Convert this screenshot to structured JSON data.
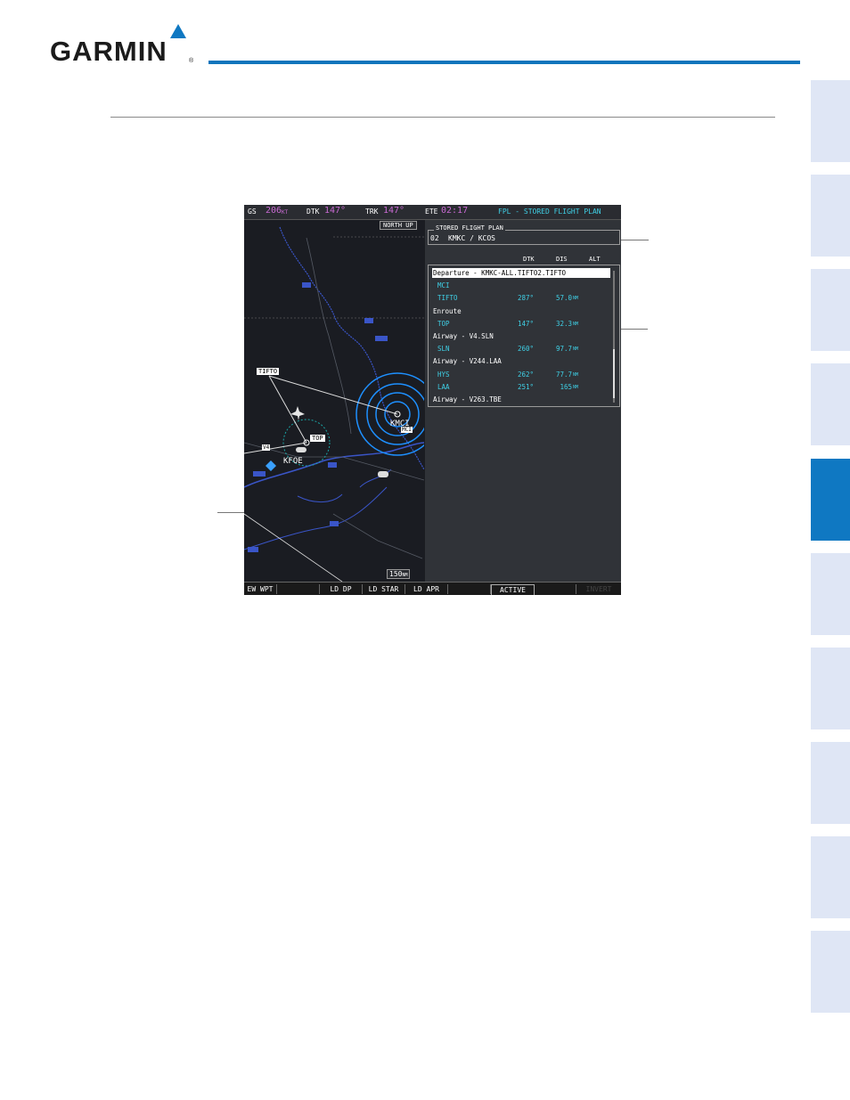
{
  "header": {
    "brand": "GARMIN",
    "registered": "®"
  },
  "screen": {
    "status_bar": {
      "gs_label": "GS",
      "gs_value": "206",
      "gs_unit": "KT",
      "dtk_label": "DTK",
      "dtk_value": "147°",
      "trk_label": "TRK",
      "trk_value": "147°",
      "ete_label": "ETE",
      "ete_value": "02:17",
      "page_title": "FPL - STORED FLIGHT PLAN"
    },
    "map": {
      "orientation": "NORTH UP",
      "range_value": "150",
      "range_unit": "NM",
      "labels": {
        "tifto": "TIFTO",
        "kmci": "KMCI",
        "mci": "MCI",
        "top": "TOP",
        "kfoe": "KFOE",
        "v4": "V4"
      }
    },
    "flight_plan": {
      "box_title": "STORED FLIGHT PLAN",
      "number": "02",
      "route": "KMKC / KCOS",
      "columns": [
        "DTK",
        "DIS",
        "ALT"
      ],
      "rows": [
        {
          "name": "Departure - KMKC-ALL.TIFTO2.TIFTO",
          "dtk": "",
          "dis": "",
          "unit": "",
          "kind": "header-selected"
        },
        {
          "name": "MCI",
          "dtk": "",
          "dis": "",
          "unit": "",
          "kind": "wpt"
        },
        {
          "name": "TIFTO",
          "dtk": "287°",
          "dis": "57.0",
          "unit": "NM",
          "kind": "wpt"
        },
        {
          "name": "Enroute",
          "dtk": "",
          "dis": "",
          "unit": "",
          "kind": "header"
        },
        {
          "name": "TOP",
          "dtk": "147°",
          "dis": "32.3",
          "unit": "NM",
          "kind": "wpt"
        },
        {
          "name": "Airway - V4.SLN",
          "dtk": "",
          "dis": "",
          "unit": "",
          "kind": "header"
        },
        {
          "name": "SLN",
          "dtk": "260°",
          "dis": "97.7",
          "unit": "NM",
          "kind": "wpt"
        },
        {
          "name": "Airway - V244.LAA",
          "dtk": "",
          "dis": "",
          "unit": "",
          "kind": "header"
        },
        {
          "name": "HYS",
          "dtk": "262°",
          "dis": "77.7",
          "unit": "NM",
          "kind": "wpt"
        },
        {
          "name": "LAA",
          "dtk": "251°",
          "dis": "165",
          "unit": "NM",
          "kind": "wpt"
        },
        {
          "name": "Airway - V263.TBE",
          "dtk": "",
          "dis": "",
          "unit": "",
          "kind": "header"
        }
      ]
    },
    "softkeys": [
      "EW WPT",
      "",
      "LD DP",
      "LD STAR",
      "LD APR",
      "",
      "ACTIVE",
      "",
      "INVERT"
    ]
  },
  "side_tabs": {
    "count": 10,
    "active_index": 4
  },
  "colors": {
    "brand_blue": "#0f78c2",
    "tab_inactive": "#dfe6f5",
    "cyan_text": "#3fd0e6",
    "magenta_text": "#c86ad2"
  }
}
